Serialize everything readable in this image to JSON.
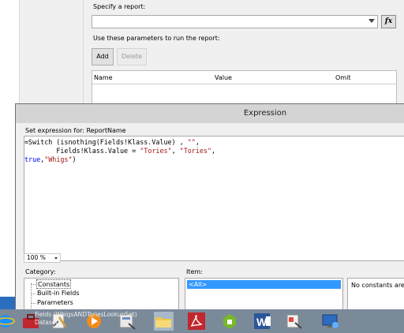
{
  "report_dialog": {
    "specify_label": "Specify a report:",
    "report_value": "",
    "fx_label": "fx",
    "params_label": "Use these parameters to run the report:",
    "add_label": "Add",
    "delete_label": "Delete",
    "columns": [
      "Name",
      "Value",
      "Omit"
    ]
  },
  "expression_window": {
    "title": "Expression",
    "set_expression_label": "Set expression for: ReportName",
    "code_lines": [
      {
        "parts": [
          {
            "t": "=Switch (isnothing(Fields!Klass.Value) , ",
            "c": "plain"
          },
          {
            "t": "\"\"",
            "c": "str"
          },
          {
            "t": ",",
            "c": "plain"
          }
        ]
      },
      {
        "parts": [
          {
            "t": "        Fields!Klass.Value = ",
            "c": "plain"
          },
          {
            "t": "\"Tories\"",
            "c": "str"
          },
          {
            "t": ", ",
            "c": "plain"
          },
          {
            "t": "\"Tories\"",
            "c": "str"
          },
          {
            "t": ",",
            "c": "plain"
          }
        ]
      },
      {
        "parts": [
          {
            "t": "true",
            "c": "kw"
          },
          {
            "t": ",",
            "c": "plain"
          },
          {
            "t": "\"Whigs\"",
            "c": "str"
          },
          {
            "t": ")",
            "c": "plain"
          }
        ]
      }
    ],
    "zoom": "100 %",
    "category_label": "Category:",
    "item_label": "Item:",
    "categories": [
      "Constants",
      "Built-in Fields",
      "Parameters",
      "Fields (WhigsANDToriesLookup_Set)",
      "Datasets"
    ],
    "selected_item": "<All>",
    "description": "No constants are a"
  },
  "taskbar": {
    "dataset_label_1": "Fields (WhigsANDToriesLookupSet)",
    "dataset_label_2": "Datasets",
    "icons": [
      "ie-icon",
      "toolbox-icon",
      "report-builder-icon",
      "media-player-icon",
      "sql-designer-icon",
      "file-explorer-icon",
      "acrobat-icon",
      "vmware-icon",
      "word-icon",
      "report-tool-icon",
      "remote-desktop-icon"
    ]
  },
  "colors": {
    "keyword": "#0000ff",
    "string": "#a31515",
    "selection": "#3399ff",
    "taskbar": "#7b8a99"
  }
}
